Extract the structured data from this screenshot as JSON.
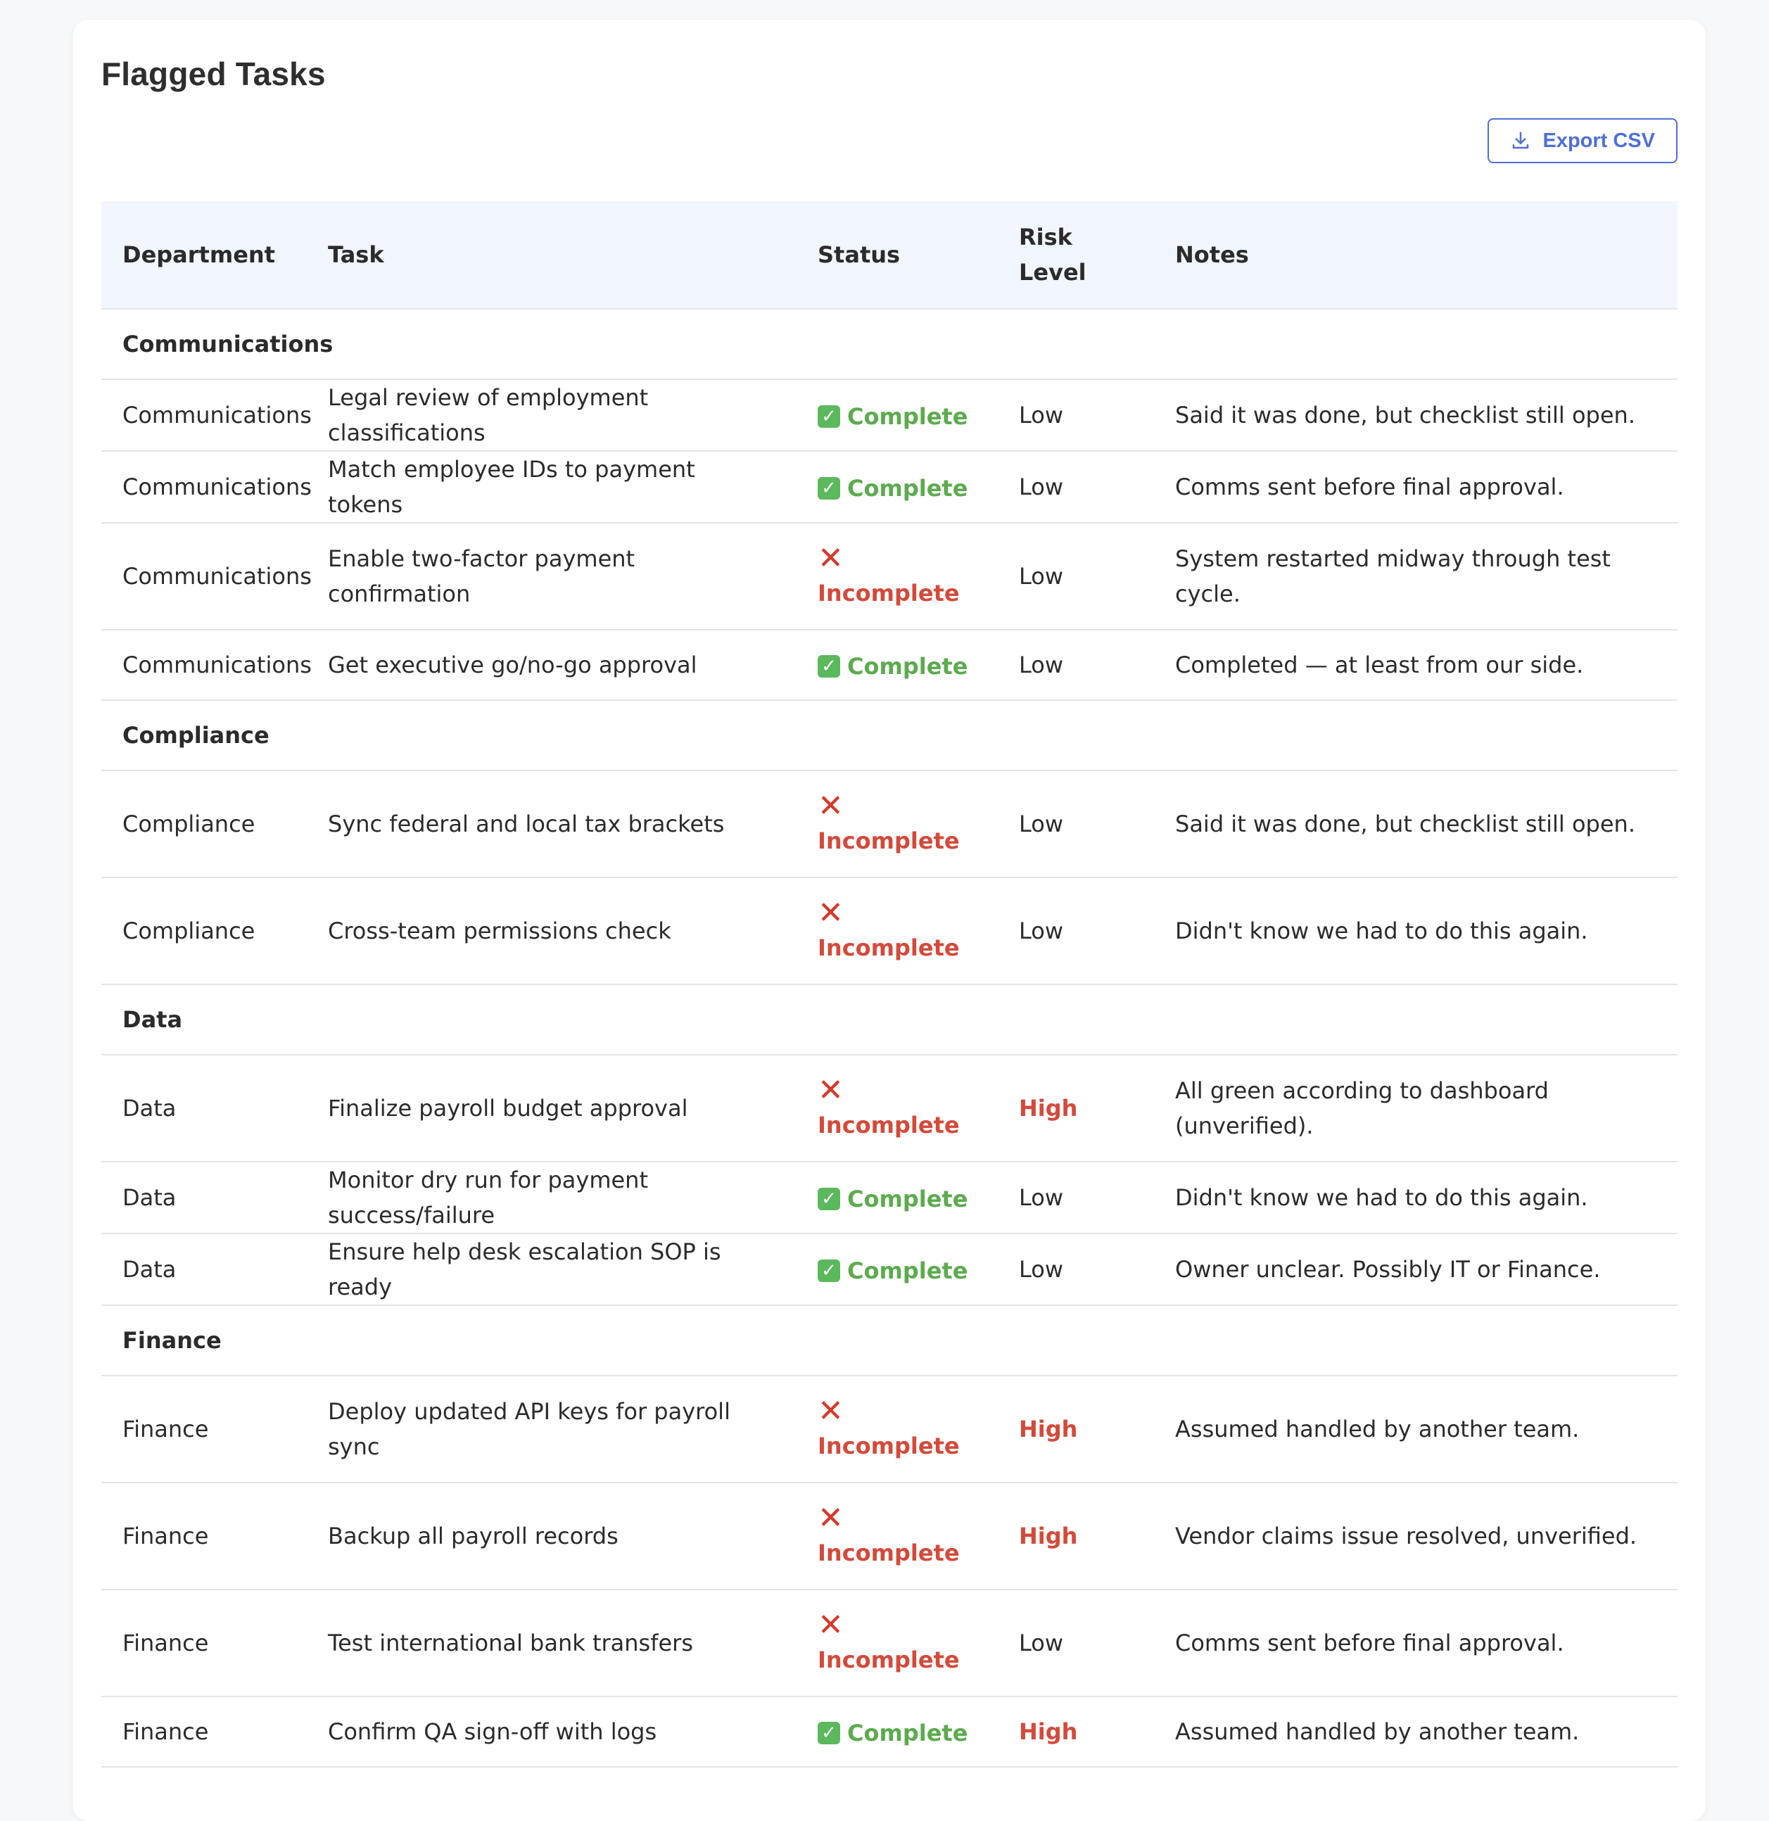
{
  "page": {
    "title": "Flagged Tasks",
    "export_label": "Export CSV"
  },
  "table": {
    "headers": {
      "department": "Department",
      "task": "Task",
      "status": "Status",
      "risk": "Risk Level",
      "notes": "Notes"
    }
  },
  "groups": [
    {
      "name": "Communications",
      "rows": [
        {
          "department": "Communications",
          "task": "Legal review of employment classifications",
          "status": "Complete",
          "risk": "Low",
          "notes": "Said it was done, but checklist still open."
        },
        {
          "department": "Communications",
          "task": "Match employee IDs to payment tokens",
          "status": "Complete",
          "risk": "Low",
          "notes": "Comms sent before final approval."
        },
        {
          "department": "Communications",
          "task": "Enable two-factor payment confirmation",
          "status": "Incomplete",
          "risk": "Low",
          "notes": "System restarted midway through test cycle."
        },
        {
          "department": "Communications",
          "task": "Get executive go/no-go approval",
          "status": "Complete",
          "risk": "Low",
          "notes": "Completed — at least from our side."
        }
      ]
    },
    {
      "name": "Compliance",
      "rows": [
        {
          "department": "Compliance",
          "task": "Sync federal and local tax brackets",
          "status": "Incomplete",
          "risk": "Low",
          "notes": "Said it was done, but checklist still open."
        },
        {
          "department": "Compliance",
          "task": "Cross-team permissions check",
          "status": "Incomplete",
          "risk": "Low",
          "notes": "Didn't know we had to do this again."
        }
      ]
    },
    {
      "name": "Data",
      "rows": [
        {
          "department": "Data",
          "task": "Finalize payroll budget approval",
          "status": "Incomplete",
          "risk": "High",
          "notes": "All green according to dashboard (unverified)."
        },
        {
          "department": "Data",
          "task": "Monitor dry run for payment success/failure",
          "status": "Complete",
          "risk": "Low",
          "notes": "Didn't know we had to do this again."
        },
        {
          "department": "Data",
          "task": "Ensure help desk escalation SOP is ready",
          "status": "Complete",
          "risk": "Low",
          "notes": "Owner unclear. Possibly IT or Finance."
        }
      ]
    },
    {
      "name": "Finance",
      "rows": [
        {
          "department": "Finance",
          "task": "Deploy updated API keys for payroll sync",
          "status": "Incomplete",
          "risk": "High",
          "notes": "Assumed handled by another team."
        },
        {
          "department": "Finance",
          "task": "Backup all payroll records",
          "status": "Incomplete",
          "risk": "High",
          "notes": "Vendor claims issue resolved, unverified."
        },
        {
          "department": "Finance",
          "task": "Test international bank transfers",
          "status": "Incomplete",
          "risk": "Low",
          "notes": "Comms sent before final approval."
        },
        {
          "department": "Finance",
          "task": "Confirm QA sign-off with logs",
          "status": "Complete",
          "risk": "High",
          "notes": "Assumed handled by another team."
        }
      ]
    }
  ],
  "status_icons": {
    "Complete": "check-box-icon",
    "Incomplete": "x-mark-icon"
  },
  "colors": {
    "accent": "#4f6fd6",
    "complete": "#5cab4e",
    "incomplete": "#d44a3a",
    "high_risk": "#d44a3a",
    "header_bg": "#f1f6fe"
  }
}
